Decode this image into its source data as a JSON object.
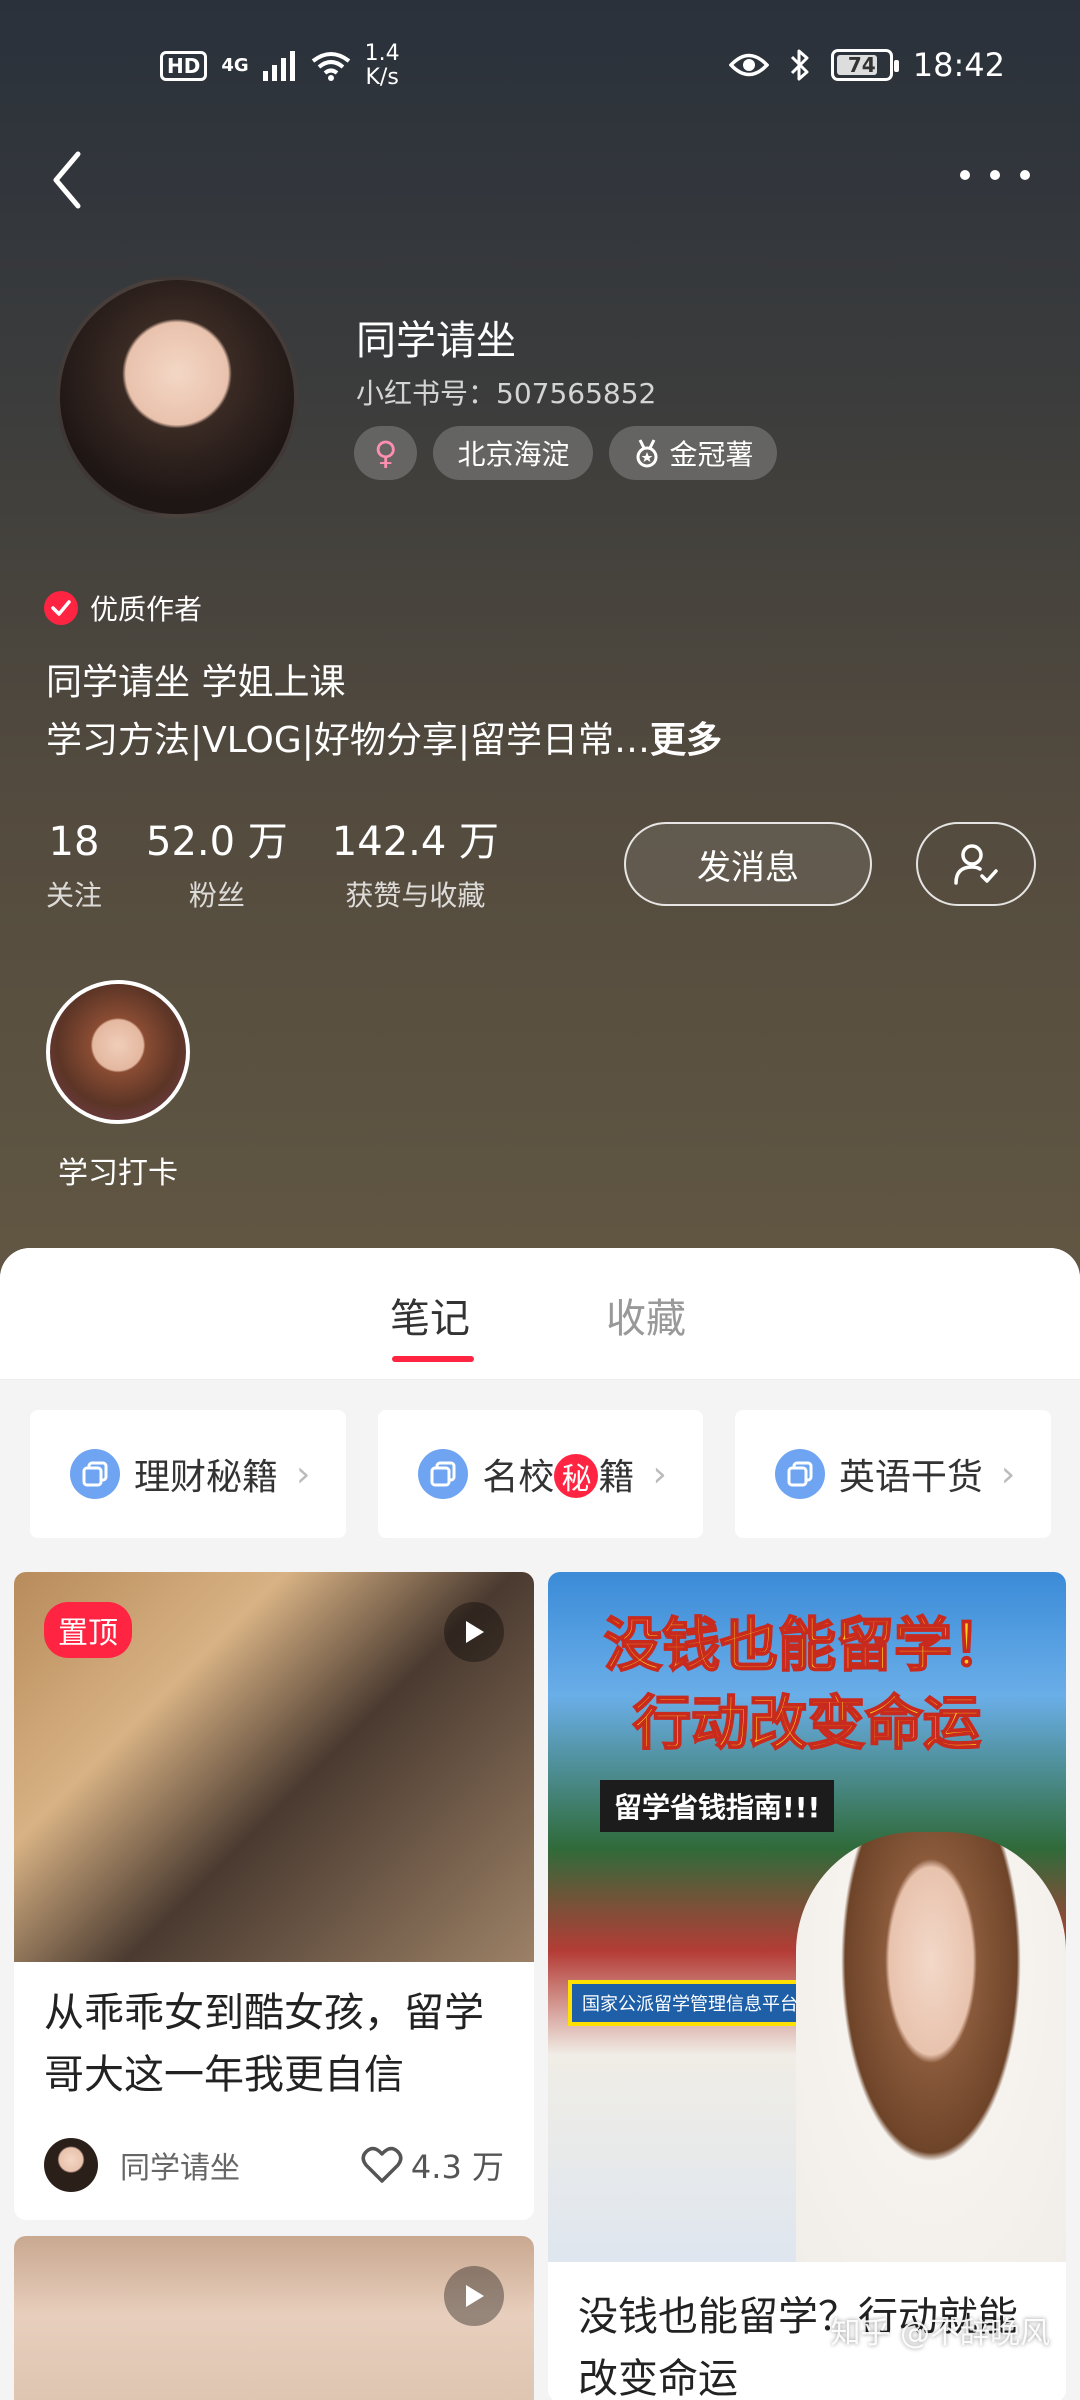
{
  "status_bar": {
    "hd": "HD",
    "network": "4G",
    "speed_value": "1.4",
    "speed_unit": "K/s",
    "battery": "74",
    "time": "18:42"
  },
  "profile": {
    "nickname": "同学请坐",
    "rednote_id": "小红书号：507565852",
    "gender_symbol": "♀",
    "location_tag": "北京海淀",
    "badge_tag": "金冠薯",
    "quality_label": "优质作者",
    "bio_line1": "同学请坐 学姐上课",
    "bio_line2": "学习方法|VLOG|好物分享|留学日常…",
    "bio_more": "更多"
  },
  "stats": [
    {
      "value": "18",
      "label": "关注"
    },
    {
      "value": "52.0 万",
      "label": "粉丝"
    },
    {
      "value": "142.4 万",
      "label": "获赞与收藏"
    }
  ],
  "actions": {
    "message": "发消息"
  },
  "highlight": {
    "label": "学习打卡"
  },
  "tabs": {
    "notes": "笔记",
    "favorites": "收藏"
  },
  "collections": [
    {
      "label": "理财秘籍"
    },
    {
      "pre": "名校",
      "secret": "秘",
      "post": "籍"
    },
    {
      "label": "英语干货"
    }
  ],
  "notes": [
    {
      "pin_label": "置顶",
      "title": "从乖乖女到酷女孩，留学哥大这一年我更自信",
      "author": "同学请坐",
      "likes": "4.3 万"
    },
    {
      "poster_line1": "没钱也能留学！",
      "poster_line2": "行动改变命运",
      "poster_sub": "留学省钱指南!!!",
      "poster_banner": "国家公派留学管理信息平台",
      "title": "没钱也能留学？行动就能改变命运"
    }
  ],
  "watermark": "知乎 @不辞晚风"
}
